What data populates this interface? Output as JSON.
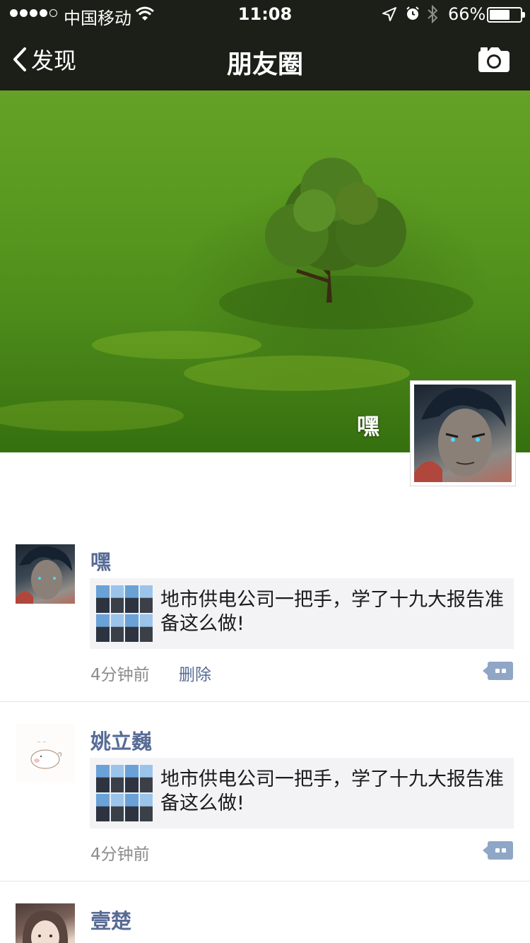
{
  "status": {
    "carrier": "中国移动",
    "time": "11:08",
    "battery": "66%",
    "battery_level": 0.66
  },
  "nav": {
    "back_label": "发现",
    "title": "朋友圈"
  },
  "cover": {
    "name": "嘿"
  },
  "posts": [
    {
      "name": "嘿",
      "share_text": "地市供电公司一把手，学了十九大报告准备这么做!",
      "time": "4分钟前",
      "delete_label": "删除"
    },
    {
      "name": "姚立巍",
      "share_text": "地市供电公司一把手，学了十九大报告准备这么做!",
      "time": "4分钟前"
    },
    {
      "name": "壹楚"
    }
  ]
}
